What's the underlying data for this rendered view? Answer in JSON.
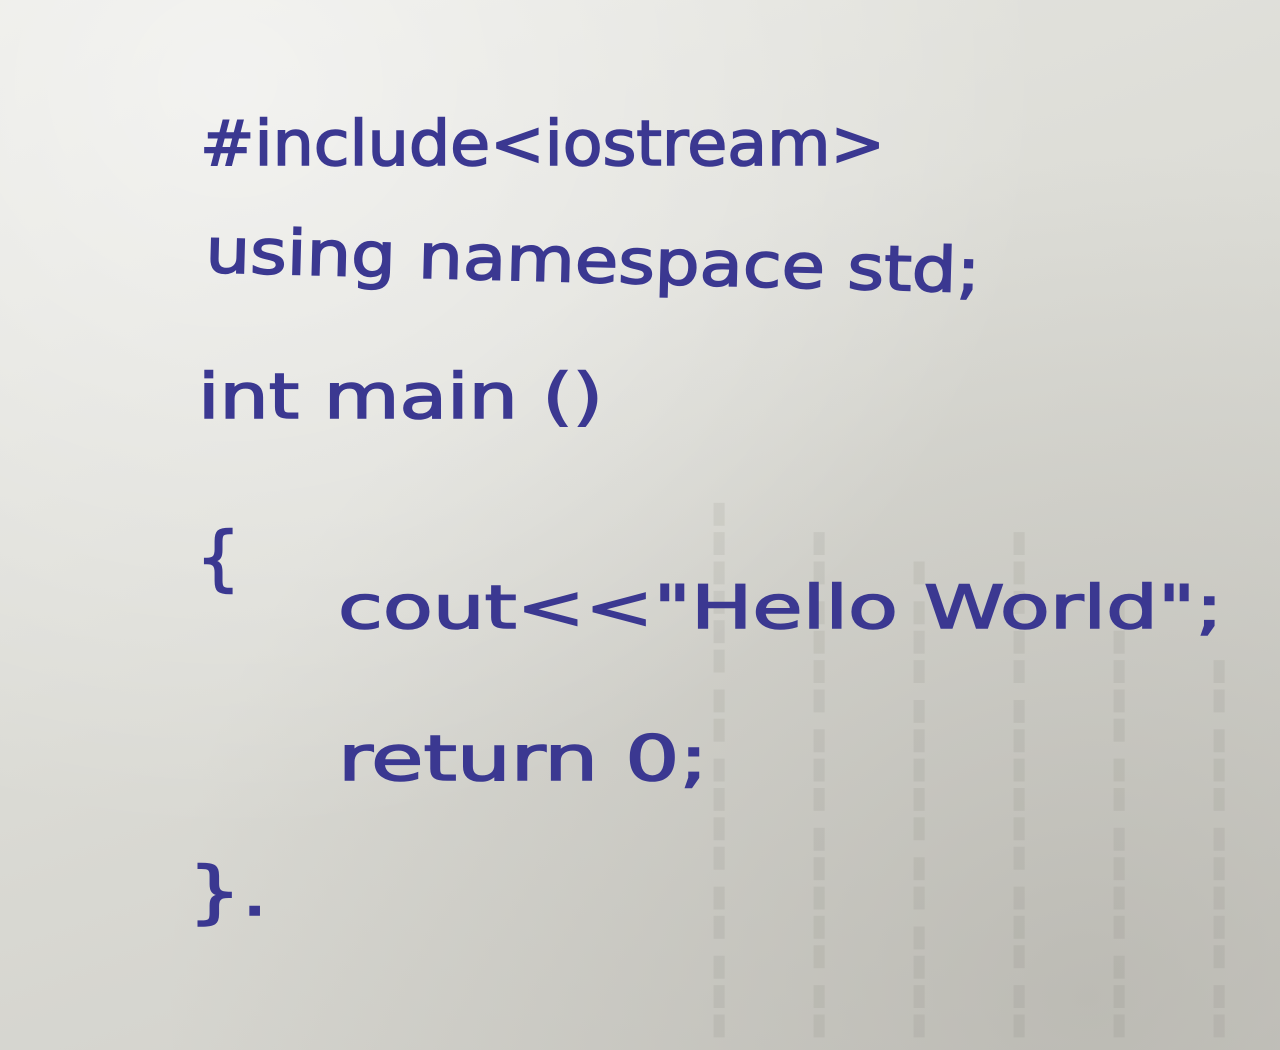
{
  "code_lines": {
    "include": "#include<iostream>",
    "using": "using namespace std;",
    "main_decl": "int main ()",
    "open_brace": "{",
    "cout": "cout<<\"Hello World\";",
    "return": "return 0;",
    "close_brace": "}."
  },
  "colors": {
    "ink": "#3b3891",
    "paper": "#dedeD8"
  }
}
